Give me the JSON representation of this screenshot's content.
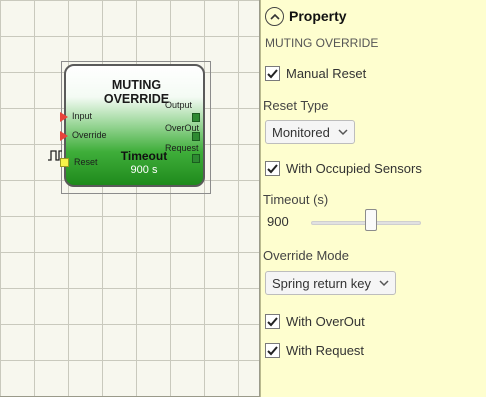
{
  "block": {
    "title": "MUTING\nOVERRIDE",
    "subtitle": "Timeout",
    "value": "900 s",
    "inputs": [
      "Input",
      "Override",
      "Reset"
    ],
    "outputs": [
      "Output",
      "OverOut",
      "Request"
    ],
    "pulse_icon": "clock-pulse-icon"
  },
  "panel": {
    "title": "Property",
    "subtitle": "MUTING OVERRIDE",
    "manual_reset": {
      "label": "Manual Reset",
      "checked": true
    },
    "reset_type": {
      "label": "Reset Type",
      "value": "Monitored"
    },
    "occupied_sensors": {
      "label": "With Occupied Sensors",
      "checked": true
    },
    "timeout": {
      "label": "Timeout (s)",
      "value": "900",
      "fraction": 0.55
    },
    "override_mode": {
      "label": "Override Mode",
      "value": "Spring return key"
    },
    "with_overout": {
      "label": "With OverOut",
      "checked": true
    },
    "with_request": {
      "label": "With Request",
      "checked": true
    }
  },
  "colors": {
    "panel_bg": "#fefecf",
    "block_green": "#3fae3a",
    "input_triangle": "#e8433a",
    "reset_square": "#f6f34a",
    "output_square": "#2e8a32"
  }
}
